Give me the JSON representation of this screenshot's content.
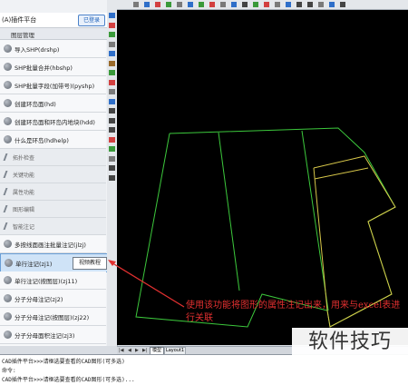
{
  "panel": {
    "title": "(A)插件平台",
    "login_button": "已登录",
    "group_title": "图层管理",
    "items": [
      {
        "label": "导入SHP(drshp)",
        "type": "tool"
      },
      {
        "label": "SHP批量合并(hbshp)",
        "type": "tool"
      },
      {
        "label": "SHP批量字段(加带号)(pyshp)",
        "type": "tool"
      },
      {
        "label": "创建环岛面(hd)",
        "type": "tool"
      },
      {
        "label": "创建环岛面和环岛内地块(hdd)",
        "type": "tool"
      },
      {
        "label": "什么是环岛(hdhelp)",
        "type": "tool"
      },
      {
        "label": "拓扑检查",
        "type": "group"
      },
      {
        "label": "关键功能",
        "type": "group"
      },
      {
        "label": "属性功能",
        "type": "group"
      },
      {
        "label": "图形编辑",
        "type": "group"
      },
      {
        "label": "智能注记",
        "type": "group"
      },
      {
        "label": "多按线面画注批量注记(jlzj)",
        "type": "tool"
      },
      {
        "label": "单行注记(zj1)",
        "type": "tool",
        "selected": true
      },
      {
        "label": "单行注记(按图层)(zj11)",
        "type": "tool"
      },
      {
        "label": "分子分母注记(zj2)",
        "type": "tool"
      },
      {
        "label": "分子分母注记(按图层)(zj22)",
        "type": "tool"
      },
      {
        "label": "分子分母面积注记(zj3)",
        "type": "tool"
      },
      {
        "label": "分子分母面积注记(按图层)(zj33)",
        "type": "tool"
      },
      {
        "label": "其他",
        "type": "group"
      }
    ],
    "tooltip": "视频教程"
  },
  "tabs": {
    "model": "模型",
    "layout": "Layout1"
  },
  "command_lines": [
    "CAD插件平台>>>请框选要查看的CAD图形(可多选)",
    "命令:",
    "CAD插件平台>>>请框选要查看的CAD图形(可多选)..."
  ],
  "annotation": {
    "text": "使用该功能将图形的属性注记出来，用来与excel表进行关联",
    "color": "#e23030"
  },
  "watermark": "软件技巧",
  "colors": {
    "polygon_green": "#3cc83c",
    "polygon_yellow": "#d8c84a",
    "canvas_bg": "#000000",
    "highlight": "#cfe3f7"
  }
}
